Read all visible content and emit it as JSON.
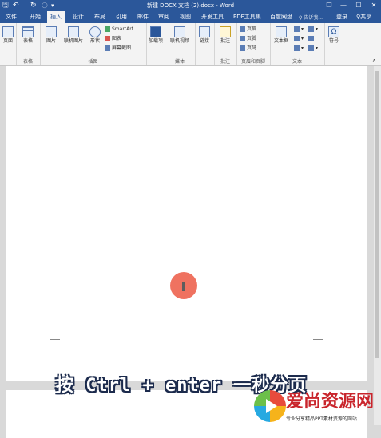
{
  "window": {
    "title": "新建 DOCX 文档 (2).docx - Word",
    "save_glyph": "🖫",
    "undo_glyph": "↶",
    "redo_glyph": "↻",
    "customize_glyph": "▾",
    "restore_glyph": "❐",
    "minimize_glyph": "—",
    "maximize_glyph": "☐",
    "close_glyph": "✕"
  },
  "tabs": [
    "文件",
    "开始",
    "插入",
    "设计",
    "布局",
    "引用",
    "邮件",
    "审阅",
    "视图",
    "开发工具",
    "PDF工具集",
    "百度网盘"
  ],
  "active_tab": "插入",
  "search_placeholder": "告诉我...",
  "login_label": "登录",
  "share_label": "共享",
  "ribbon": {
    "pages": {
      "button": "页面",
      "label": ""
    },
    "tables": {
      "button": "表格",
      "label": "表格"
    },
    "illustrations": {
      "picture": "图片",
      "online_picture": "联机图片",
      "shapes": "形状",
      "smartart": "SmartArt",
      "chart": "图表",
      "screenshot": "屏幕截图",
      "label": "插图"
    },
    "addins": {
      "button": "加载项",
      "label": ""
    },
    "media": {
      "button": "联机视频",
      "label": "媒体"
    },
    "links": {
      "button": "链接",
      "label": ""
    },
    "comments": {
      "button": "批注",
      "label": "批注"
    },
    "header_footer": {
      "header": "页眉",
      "footer": "页脚",
      "page_number": "页码",
      "label": "页眉和页脚"
    },
    "text": {
      "textbox": "文本框",
      "label": "文本"
    },
    "symbols": {
      "button": "符号",
      "label": ""
    }
  },
  "caption": "按 Ctrl + enter 一秒分页",
  "watermark": {
    "name": "爱尚资源网",
    "tagline": "专业分享精品PPT素材资源的网站"
  },
  "icons": {
    "save": "save-icon",
    "undo": "undo-icon",
    "redo": "redo-icon",
    "share": "person-icon"
  }
}
